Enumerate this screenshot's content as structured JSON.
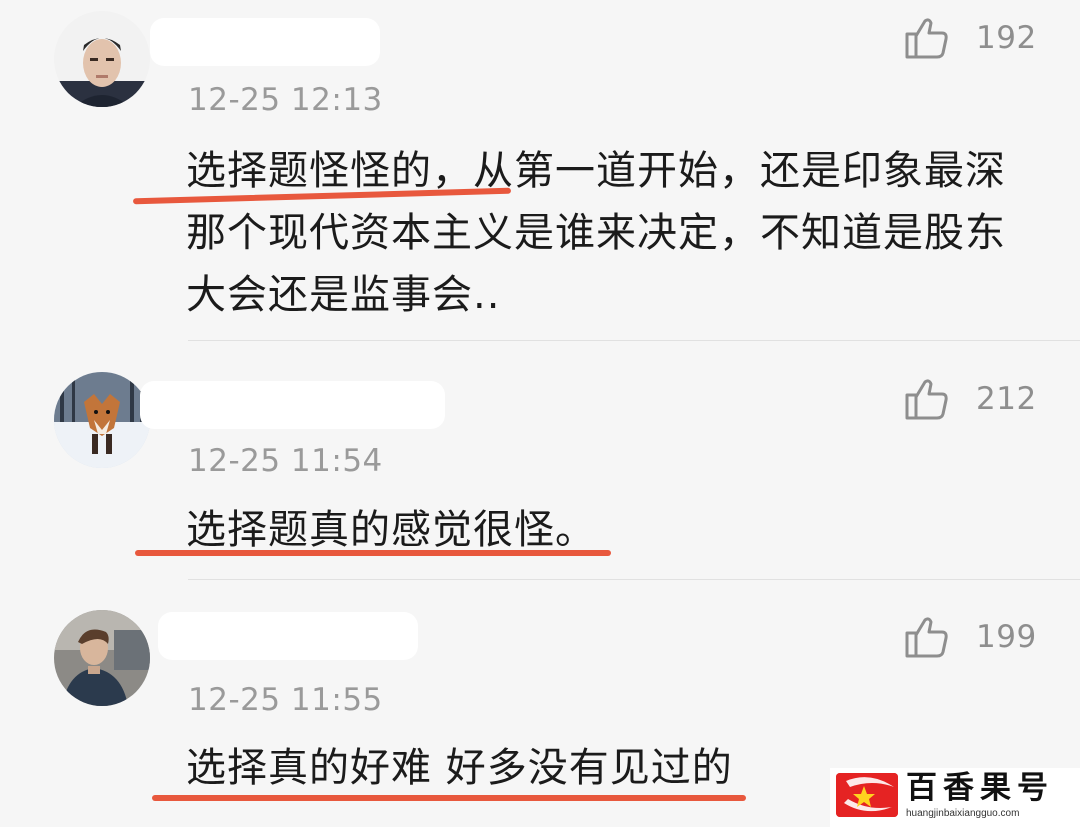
{
  "comments": [
    {
      "timestamp": "12-25 12:13",
      "likes": "192",
      "text": "选择题怪怪的，从第一道开始，还是印象最深那个现代资本主义是谁来决定，不知道是股东大会还是监事会.."
    },
    {
      "timestamp": "12-25 11:54",
      "likes": "212",
      "text": "选择题真的感觉很怪。"
    },
    {
      "timestamp": "12-25 11:55",
      "likes": "199",
      "text": "选择真的好难 好多没有见过的"
    }
  ],
  "watermark": {
    "title": "百香果号",
    "url": "huangjinbaixiangguo.com"
  },
  "icons": {
    "like": "thumbs-up-icon",
    "logo": "star-logo-icon"
  },
  "colors": {
    "underline": "#e8583d",
    "background": "#f6f6f6",
    "watermark_logo": "#e52323"
  }
}
